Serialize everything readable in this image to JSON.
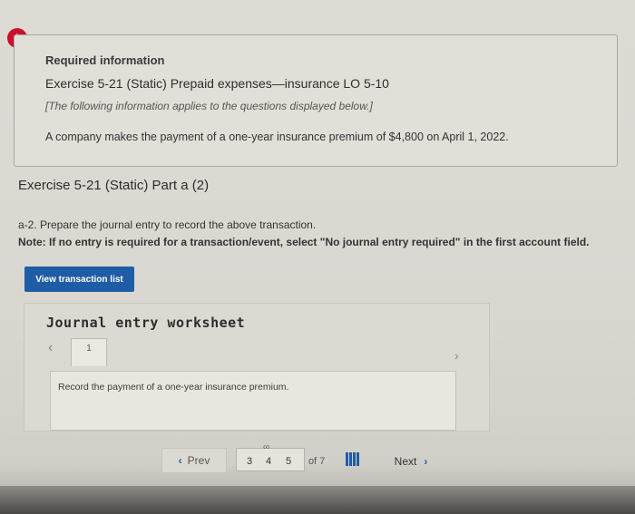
{
  "alert": {
    "icon_glyph": "!",
    "color": "#c8102e"
  },
  "info": {
    "title": "Required information",
    "exercise": "Exercise 5-21 (Static) Prepaid expenses—insurance LO 5-10",
    "note": "[The following information applies to the questions displayed below.]",
    "body": "A company makes the payment of a one-year insurance premium of $4,800 on April 1, 2022."
  },
  "part": {
    "title": "Exercise 5-21 (Static) Part a (2)",
    "instruction": "a-2. Prepare the journal entry to record the above transaction.",
    "note": "Note: If no entry is required for a transaction/event, select \"No journal entry required\" in the first account field."
  },
  "buttons": {
    "view_transactions": "View transaction list"
  },
  "worksheet": {
    "title": "Journal entry worksheet",
    "tab_label": "1",
    "record_text": "Record the payment of a one-year insurance premium."
  },
  "pager": {
    "prev_label": "Prev",
    "next_label": "Next",
    "pages": [
      "3",
      "4",
      "5"
    ],
    "current_page": "4",
    "total_text": "of 7"
  },
  "accent_color": "#1f5ca6"
}
